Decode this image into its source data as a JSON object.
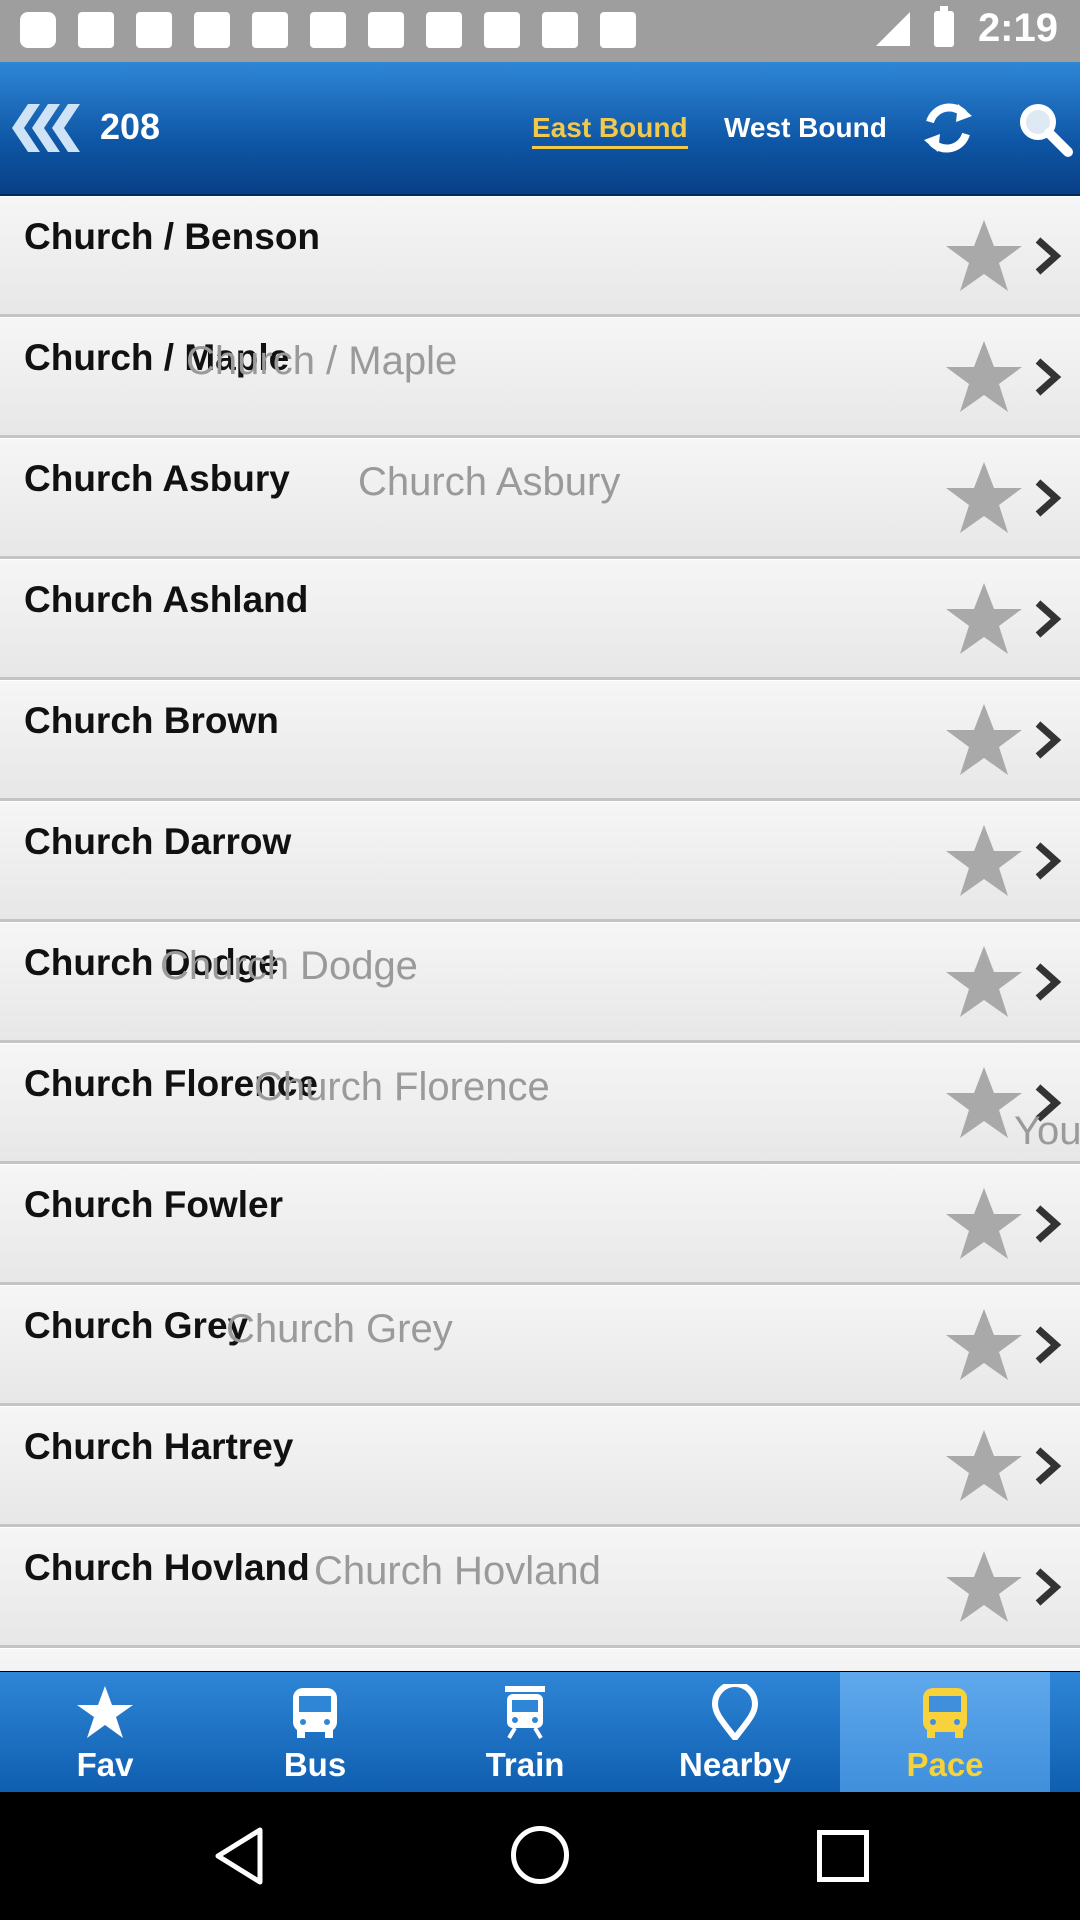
{
  "status_bar": {
    "time": "2:19"
  },
  "header": {
    "route_number": "208",
    "tab_east": "East Bound",
    "tab_west": "West Bound",
    "active_tab": "East Bound"
  },
  "stops": [
    {
      "name": "Church / Benson",
      "ghost": ""
    },
    {
      "name": "Church / Maple",
      "ghost": "Church / Maple"
    },
    {
      "name": "Church Asbury",
      "ghost": "Church Asbury"
    },
    {
      "name": "Church Ashland",
      "ghost": ""
    },
    {
      "name": "Church Brown",
      "ghost": ""
    },
    {
      "name": "Church Darrow",
      "ghost": ""
    },
    {
      "name": "Church Dodge",
      "ghost": "Church Dodge"
    },
    {
      "name": "Church Florence",
      "ghost": "Church Florence"
    },
    {
      "name": "Church Fowler",
      "ghost": ""
    },
    {
      "name": "Church Grey",
      "ghost": "Church Grey"
    },
    {
      "name": "Church Hartrey",
      "ghost": ""
    },
    {
      "name": "Church Hovland",
      "ghost": "Church Hovland"
    }
  ],
  "overlay_text": "You",
  "bottom_nav": [
    {
      "label": "Fav",
      "icon": "star-icon"
    },
    {
      "label": "Bus",
      "icon": "bus-icon"
    },
    {
      "label": "Train",
      "icon": "train-icon"
    },
    {
      "label": "Nearby",
      "icon": "location-pin-icon"
    },
    {
      "label": "Pace",
      "icon": "pace-bus-icon",
      "active": true
    }
  ],
  "colors": {
    "header_blue": "#0e57a6",
    "accent_yellow": "#f2c94c"
  }
}
